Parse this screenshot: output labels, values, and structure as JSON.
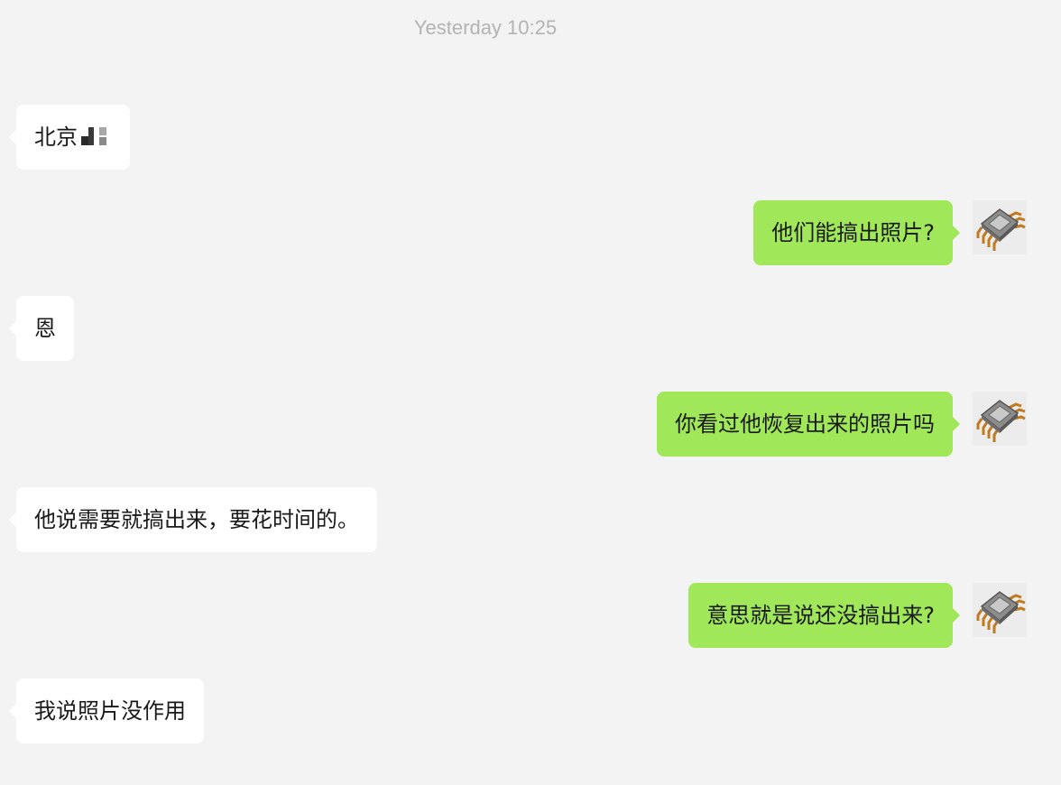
{
  "timestamp": "Yesterday 10:25",
  "messages": [
    {
      "side": "left",
      "text": "北京",
      "redacted": true
    },
    {
      "side": "right",
      "text": "他们能搞出照片?"
    },
    {
      "side": "left",
      "text": "恩"
    },
    {
      "side": "right",
      "text": "你看过他恢复出来的照片吗"
    },
    {
      "side": "left",
      "text": "他说需要就搞出来，要花时间的。"
    },
    {
      "side": "right",
      "text": "意思就是说还没搞出来?"
    },
    {
      "side": "left",
      "text": "我说照片没作用"
    }
  ],
  "colors": {
    "background": "#f3f3f3",
    "incoming_bubble": "#ffffff",
    "outgoing_bubble": "#a0e75a",
    "timestamp": "#b3b3b3"
  },
  "avatar_icon": "microchip-icon"
}
